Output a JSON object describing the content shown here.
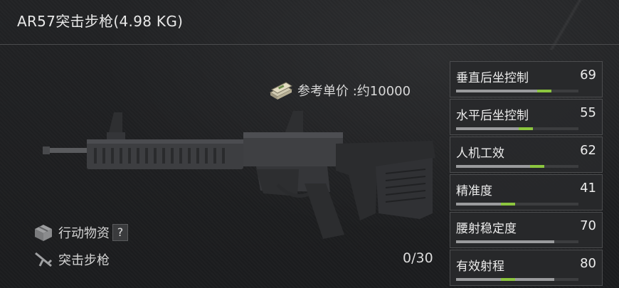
{
  "weapon": {
    "title": "AR57突击步枪(4.98 KG)",
    "price_label": "参考单价 :约10000",
    "category_1": "行动物资",
    "help_glyph": "?",
    "category_2": "突击步枪",
    "ammo": "0/30"
  },
  "stats": [
    {
      "label": "垂直后坐控制",
      "value": "69",
      "fill": 0.69,
      "marker": 0.78
    },
    {
      "label": "水平后坐控制",
      "value": "55",
      "fill": 0.55,
      "marker": 0.63
    },
    {
      "label": "人机工效",
      "value": "62",
      "fill": 0.62,
      "marker": 0.72
    },
    {
      "label": "精准度",
      "value": "41",
      "fill": 0.41,
      "marker": 0.48
    },
    {
      "label": "腰射稳定度",
      "value": "70",
      "fill": 0.8,
      "marker": null
    },
    {
      "label": "有效射程",
      "value": "80",
      "fill": 0.8,
      "marker": 0.48
    }
  ],
  "colors": {
    "background": "#1c1d1f",
    "bar_track": "#3c3d3f",
    "bar_fill": "#9a9b9d",
    "bar_marker": "#8cc63f"
  },
  "icons": {
    "price": "money-stack-icon",
    "category_1": "supply-crate-icon",
    "category_2": "rifle-icon"
  }
}
